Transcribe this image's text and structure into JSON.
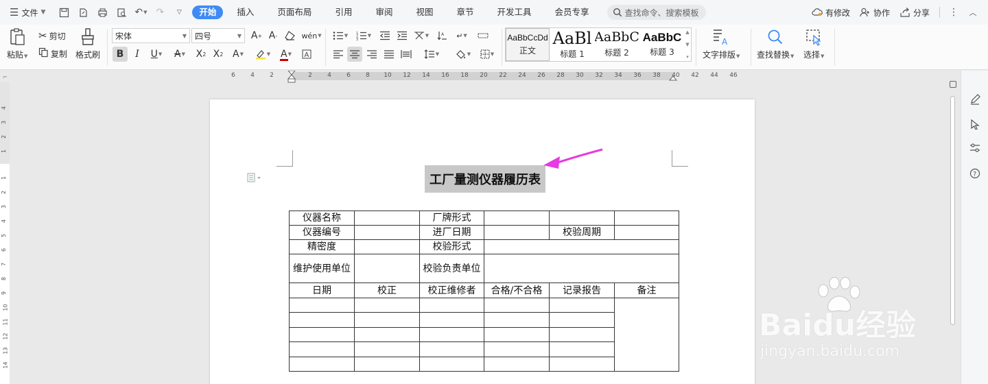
{
  "menubar": {
    "file_label": "文件",
    "tabs": [
      "开始",
      "插入",
      "页面布局",
      "引用",
      "审阅",
      "视图",
      "章节",
      "开发工具",
      "会员专享"
    ],
    "active_tab": "开始",
    "search_placeholder": "查找命令、搜索模板",
    "right": {
      "has_changes": "有修改",
      "collab": "协作",
      "share": "分享"
    }
  },
  "ribbon": {
    "paste": "粘贴",
    "cut": "剪切",
    "copy": "复制",
    "format_painter": "格式刷",
    "font_name": "宋体",
    "font_size": "四号",
    "styles": [
      {
        "sample": "AaBbCcDd",
        "name": "正文"
      },
      {
        "sample": "AaBl",
        "name": "标题 1"
      },
      {
        "sample": "AaBbC",
        "name": "标题 2"
      },
      {
        "sample": "AaBbC",
        "name": "标题 3"
      }
    ],
    "text_layout": "文字排版",
    "find_replace": "查找替换",
    "select": "选择"
  },
  "ruler": {
    "h_ticks": [
      "6",
      "4",
      "2",
      "2",
      "4",
      "6",
      "8",
      "10",
      "12",
      "14",
      "16",
      "18",
      "20",
      "22",
      "24",
      "26",
      "28",
      "30",
      "32",
      "34",
      "36",
      "38",
      "40",
      "42",
      "44",
      "46"
    ],
    "v_ticks_top": [
      "4",
      "3",
      "2",
      "1"
    ],
    "v_ticks_body": [
      "1",
      "2",
      "3",
      "4",
      "5",
      "6",
      "7",
      "8",
      "9",
      "10",
      "11",
      "12",
      "13",
      "14"
    ]
  },
  "document": {
    "title": "工厂量测仪器履历表",
    "table": {
      "row1": [
        "仪器名称",
        "",
        "厂牌形式",
        "",
        "",
        ""
      ],
      "row2": [
        "仪器编号",
        "",
        "进厂日期",
        "",
        "校验周期",
        ""
      ],
      "row3": [
        "精密度",
        "",
        "校验形式",
        ""
      ],
      "row4": [
        "维护使用单位",
        "",
        "校验负责单位",
        ""
      ],
      "header": [
        "日期",
        "校正",
        "校正维修者",
        "合格/不合格",
        "记录报告",
        "备注"
      ]
    }
  },
  "watermark": {
    "brand": "Baidu经验",
    "url": "jingyan.baidu.com"
  },
  "colors": {
    "accent": "#3e8bf5",
    "arrow": "#e53be0",
    "title_highlight": "#c8c8c8"
  }
}
